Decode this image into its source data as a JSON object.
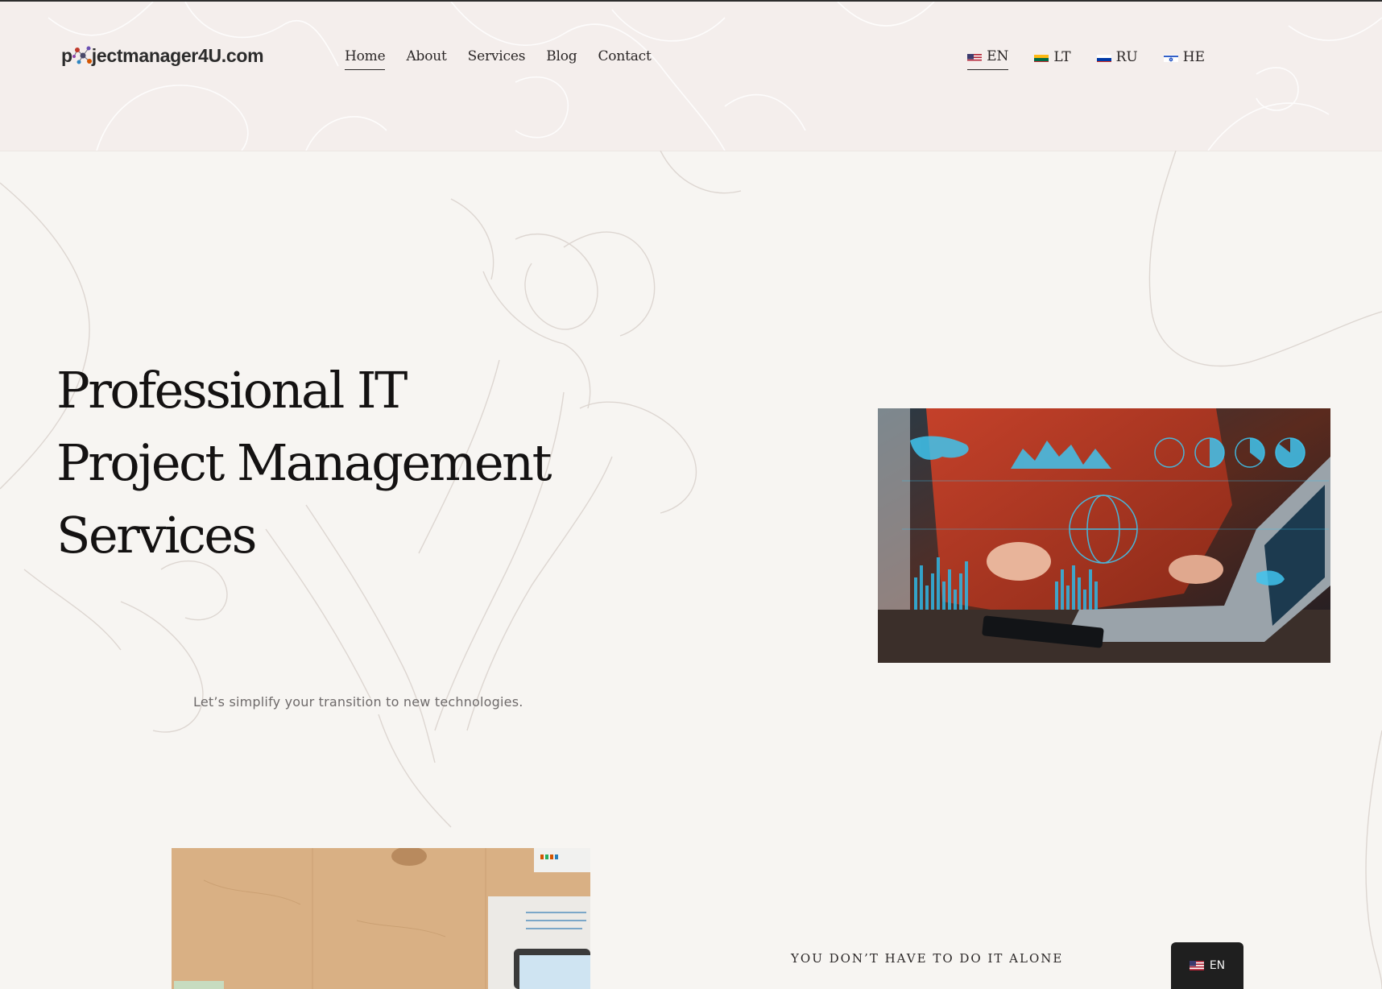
{
  "header": {
    "logo_prefix": "p",
    "logo_text": "jectmanager4U.com",
    "nav": [
      {
        "label": "Home",
        "active": true
      },
      {
        "label": "About",
        "active": false
      },
      {
        "label": "Services",
        "active": false
      },
      {
        "label": "Blog",
        "active": false
      },
      {
        "label": "Contact",
        "active": false
      }
    ],
    "languages": [
      {
        "code": "EN",
        "active": true
      },
      {
        "code": "LT",
        "active": false
      },
      {
        "code": "RU",
        "active": false
      },
      {
        "code": "HE",
        "active": false
      }
    ]
  },
  "hero": {
    "title_lines": [
      "Professional IT",
      "Project Management",
      "Services"
    ],
    "tagline": "Let’s simplify your transition to new technologies."
  },
  "section2": {
    "eyebrow": "YOU DON’T HAVE TO DO IT ALONE"
  },
  "language_widget": {
    "label": "EN"
  },
  "colors": {
    "background": "#f7f5f2",
    "header_background": "#f4eeec",
    "text": "#1e1c1c",
    "widget": "#1f1f1f"
  }
}
